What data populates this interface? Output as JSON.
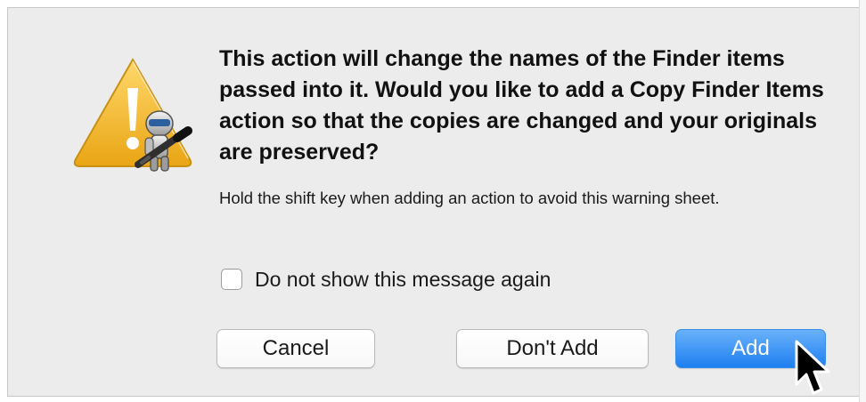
{
  "dialog": {
    "message": "This action will change the names of the Finder items passed into it.  Would you like to add a Copy Finder Items action so that the copies are changed and your originals are preserved?",
    "informative_text": "Hold the shift key when adding an action to avoid this warning sheet.",
    "checkbox": {
      "label": "Do not show this message again",
      "checked": false
    },
    "buttons": {
      "cancel": "Cancel",
      "dont_add": "Don't Add",
      "add": "Add"
    },
    "icon": "automator-warning-icon"
  },
  "colors": {
    "dialog_background": "#ececec",
    "default_button": "#1e7ff0",
    "warning_yellow": "#f2bd2e"
  },
  "cursor": "arrow-pointer-icon"
}
